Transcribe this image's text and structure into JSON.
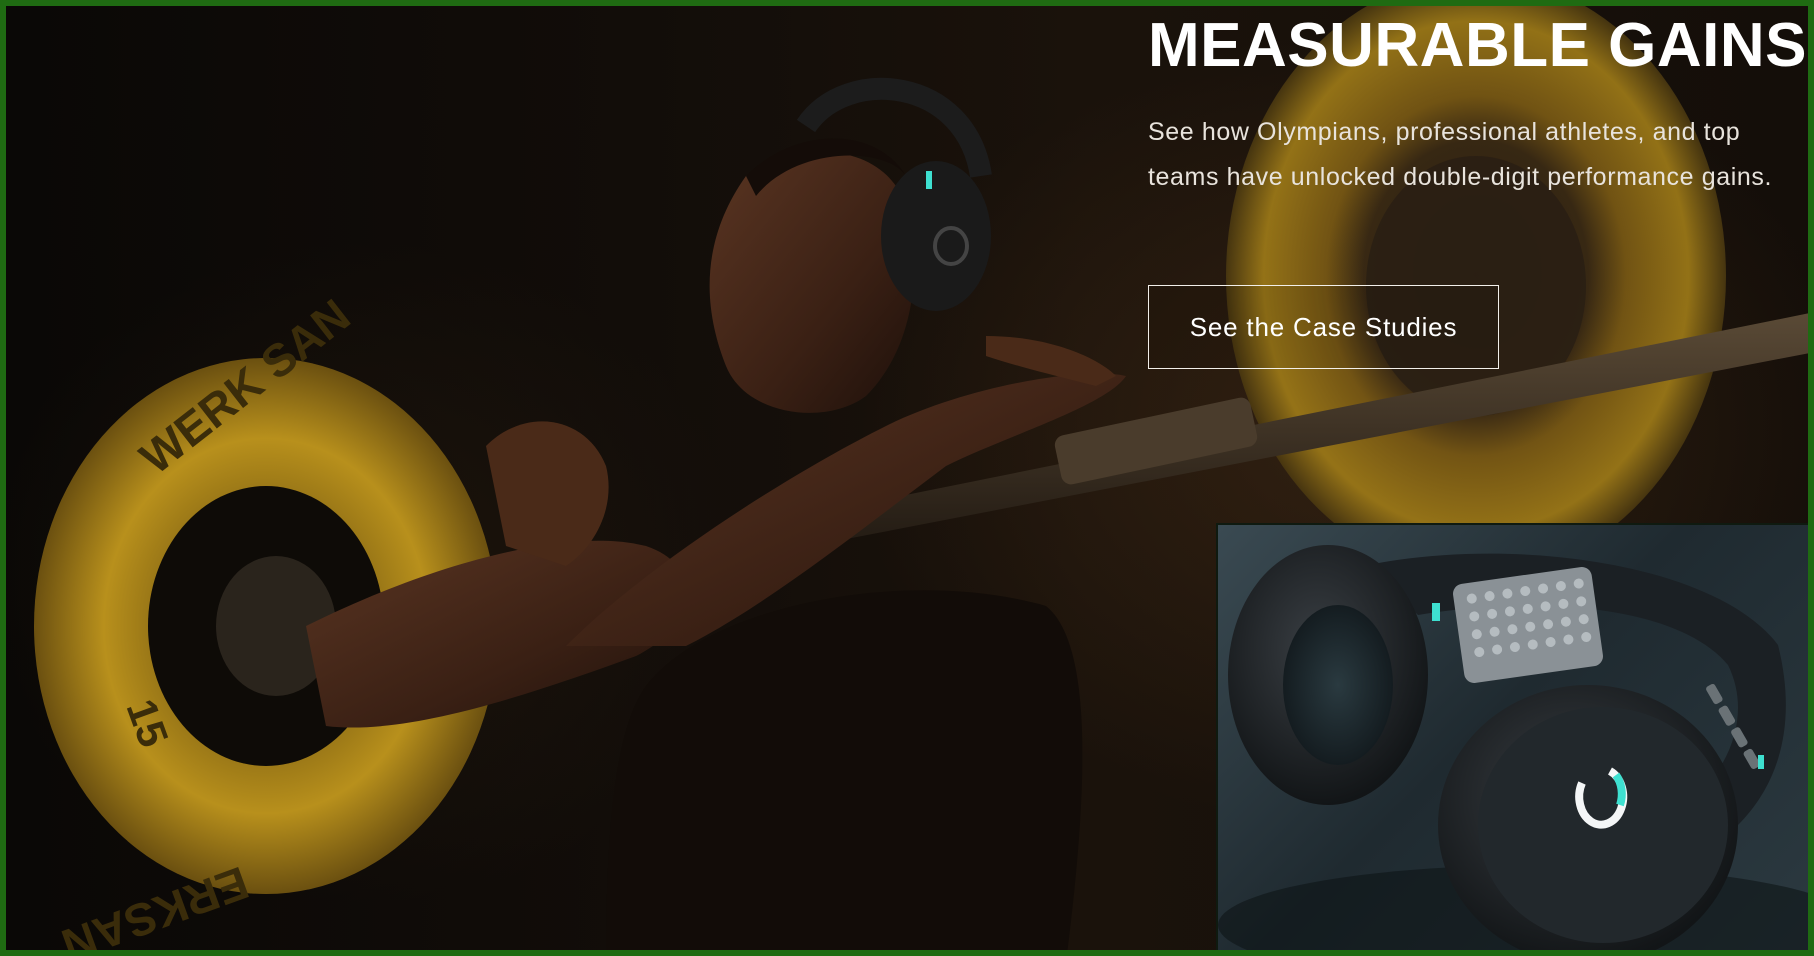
{
  "hero": {
    "headline": "MEASURABLE GAINS",
    "subtext": "See how Olympians, professional athletes, and top teams have unlocked double-digit performance gains.",
    "cta_label": "See the Case Studies",
    "plate_text_top": "WERK SAN",
    "plate_text_bottom": "ERKSAN",
    "plate_weight": "15"
  },
  "colors": {
    "frame_border": "#1f6b12",
    "plate_yellow": "#b8901c",
    "accent_teal": "#3ee0d0",
    "headline_white": "#ffffff"
  },
  "icons": {
    "headphone_logo": "ring-logo-icon"
  }
}
